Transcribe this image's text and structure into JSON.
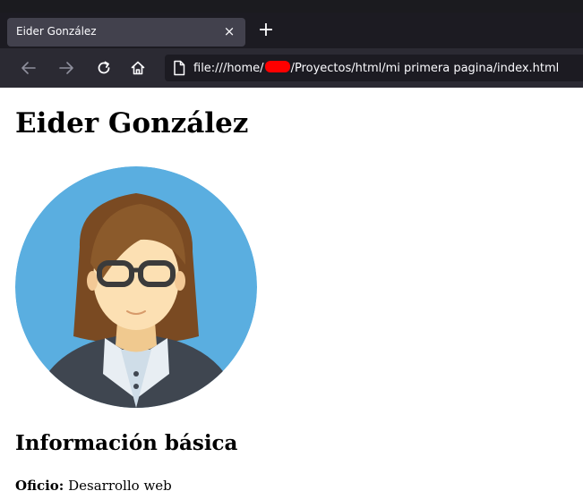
{
  "browser": {
    "tab": {
      "title": "Eider González",
      "close_glyph": "×"
    },
    "new_tab_glyph": "+",
    "nav": {
      "back_icon": "arrow-left-icon",
      "forward_icon": "arrow-right-icon",
      "reload_icon": "reload-icon",
      "home_icon": "home-icon"
    },
    "url": {
      "prefix": "file:///home/",
      "suffix": "/Proyectos/html/mi primera pagina/index.html",
      "page_icon": "page-icon",
      "redaction_color": "#ff0000"
    },
    "colors": {
      "tabbar": "#1c1b22",
      "navbar": "#2b2a33",
      "active_tab": "#42414d"
    }
  },
  "page": {
    "title": "Eider González",
    "avatar": {
      "icon": "woman-with-glasses-avatar",
      "background": "#5aaee0"
    },
    "section_title": "Información básica",
    "info": {
      "label": "Oficio:",
      "value": "Desarrollo web"
    }
  }
}
